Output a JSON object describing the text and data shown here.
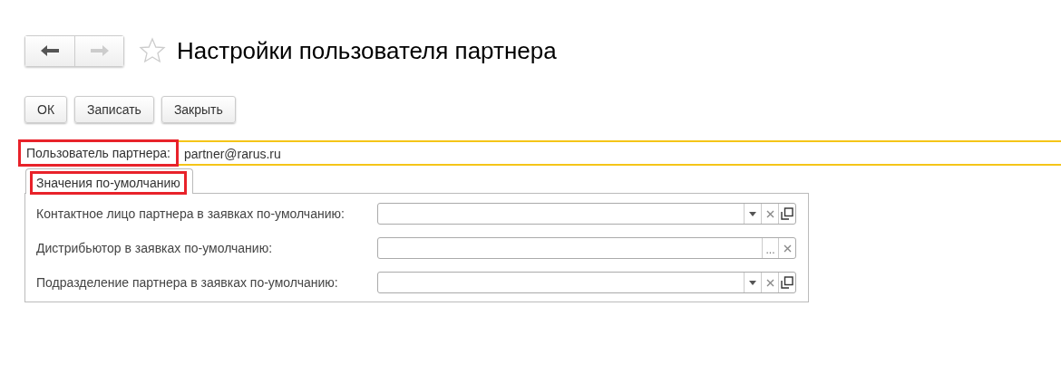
{
  "title": "Настройки пользователя партнера",
  "favorite": false,
  "nav": {
    "back_disabled": false,
    "forward_disabled": true
  },
  "buttons": [
    "ОК",
    "Записать",
    "Закрыть"
  ],
  "user_field": {
    "label": "Пользователь партнера:",
    "value": "partner@rarus.ru",
    "focused": true,
    "highlighted": true
  },
  "tabs": [
    {
      "label": "Значения по-умолчанию",
      "selected": true,
      "highlighted": true
    }
  ],
  "fields": [
    {
      "label": "Контактное лицо партнера в заявках по-умолчанию:",
      "kind": "dropdown"
    },
    {
      "label": "Дистрибьютор в заявках по-умолчанию:",
      "kind": "choice",
      "choice_text": "..."
    },
    {
      "label": "Подразделение партнера в заявках по-умолчанию:",
      "kind": "dropdown"
    }
  ]
}
